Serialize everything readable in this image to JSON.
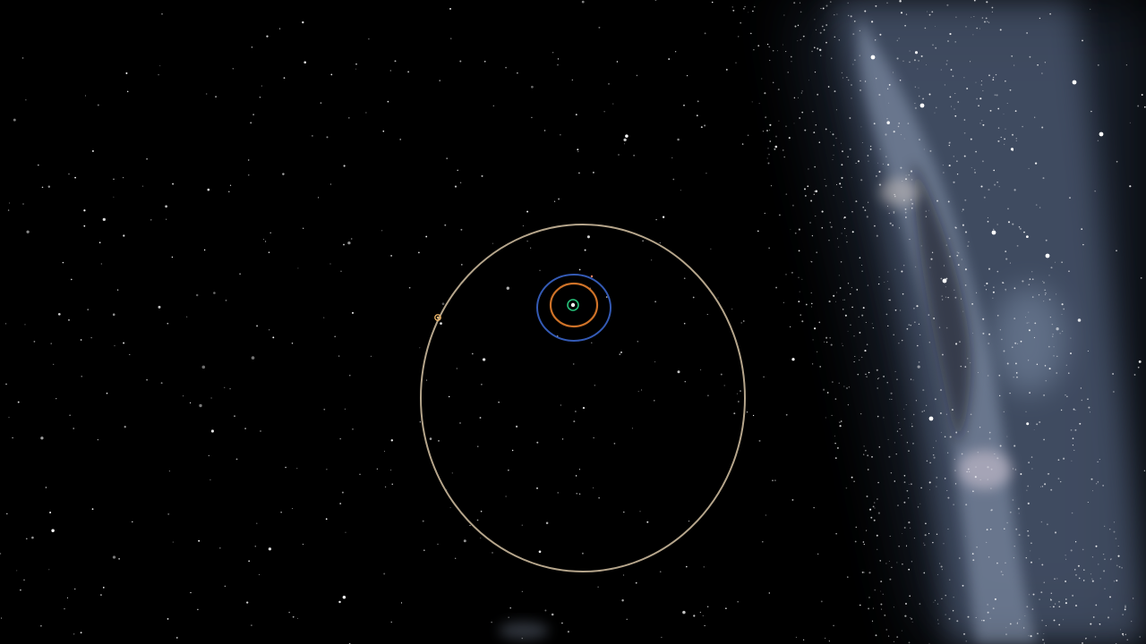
{
  "scene": {
    "background_color": "#000000",
    "milky_way_tint": "#9fb2cf",
    "star_color": "#ffffff"
  },
  "orbits": [
    {
      "name": "outer-orbit",
      "color": "#c9b79a"
    },
    {
      "name": "blue-orbit",
      "color": "#3a64c8"
    },
    {
      "name": "orange-orbit",
      "color": "#d9782a"
    },
    {
      "name": "green-orbit",
      "color": "#27c27a"
    }
  ],
  "bodies": [
    {
      "name": "sun",
      "color": "#ffffff"
    },
    {
      "name": "outer-planet",
      "color": "#e7b066"
    },
    {
      "name": "small-body",
      "color": "#ff8060"
    }
  ],
  "icons": [
    "sun-icon",
    "planet-icon"
  ]
}
